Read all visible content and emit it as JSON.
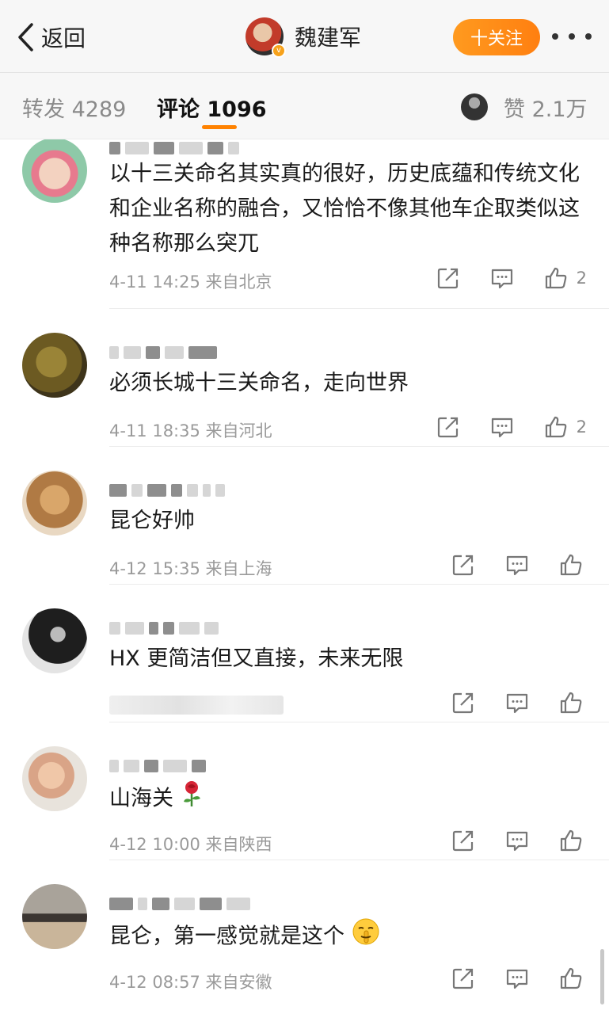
{
  "header": {
    "back_label": "返回",
    "profile_name": "魏建军",
    "follow_label": "十关注"
  },
  "tabs": {
    "repost": "转发 4289",
    "comment": "评论 1096",
    "like": "赞 2.1万"
  },
  "comments": [
    {
      "text": "以十三关命名其实真的很好，历史底蕴和传统文化和企业名称的融合，又恰恰不像其他车企取类似这种名称那么突兀",
      "meta": "4-11 14:25 来自北京",
      "likes": "2"
    },
    {
      "text": "必须长城十三关命名，走向世界",
      "meta": "4-11 18:35 来自河北",
      "likes": "2"
    },
    {
      "text": "昆仑好帅",
      "meta": "4-12 15:35 来自上海",
      "likes": ""
    },
    {
      "text": "HX 更简洁但又直接，未来无限",
      "meta": "",
      "likes": ""
    },
    {
      "text": "山海关",
      "meta": "4-12 10:00 来自陕西",
      "likes": ""
    },
    {
      "text": "昆仑，第一感觉就是这个",
      "meta": "4-12 08:57 来自安徽",
      "likes": ""
    }
  ],
  "icons": {
    "back": "chevron-left-icon",
    "more": "more-icon",
    "repost": "repost-icon",
    "reply": "comment-icon",
    "like": "thumbs-up-icon",
    "rose": "rose-emoji-icon",
    "shush": "shushing-face-emoji-icon"
  },
  "colors": {
    "accent": "#ff8200",
    "text": "#1a1a1a",
    "meta": "#9a9a9a"
  }
}
